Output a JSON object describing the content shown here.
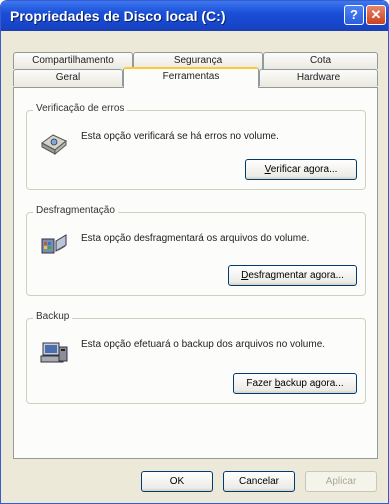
{
  "window": {
    "title": "Propriedades de Disco local (C:)",
    "help_glyph": "?",
    "close_glyph": "✕"
  },
  "tabs_row1": [
    {
      "label": "Compartilhamento"
    },
    {
      "label": "Segurança"
    },
    {
      "label": "Cota"
    }
  ],
  "tabs_row2": [
    {
      "label": "Geral"
    },
    {
      "label": "Ferramentas",
      "active": true
    },
    {
      "label": "Hardware"
    }
  ],
  "groups": [
    {
      "title": "Verificação de erros",
      "icon": "disk-check-icon",
      "description": "Esta opção verificará se há erros no volume.",
      "button": {
        "mnemonic": "V",
        "rest": "erificar agora..."
      }
    },
    {
      "title": "Desfragmentação",
      "icon": "defrag-icon",
      "description": "Esta opção desfragmentará os arquivos do volume.",
      "button": {
        "mnemonic": "D",
        "rest": "esfragmentar agora..."
      }
    },
    {
      "title": "Backup",
      "icon": "backup-icon",
      "description": "Esta opção efetuará o backup dos arquivos no volume.",
      "button": {
        "pre": "Fazer ",
        "mnemonic": "b",
        "rest": "ackup agora..."
      }
    }
  ],
  "footer": {
    "ok": "OK",
    "cancel": "Cancelar",
    "apply": "Aplicar"
  }
}
